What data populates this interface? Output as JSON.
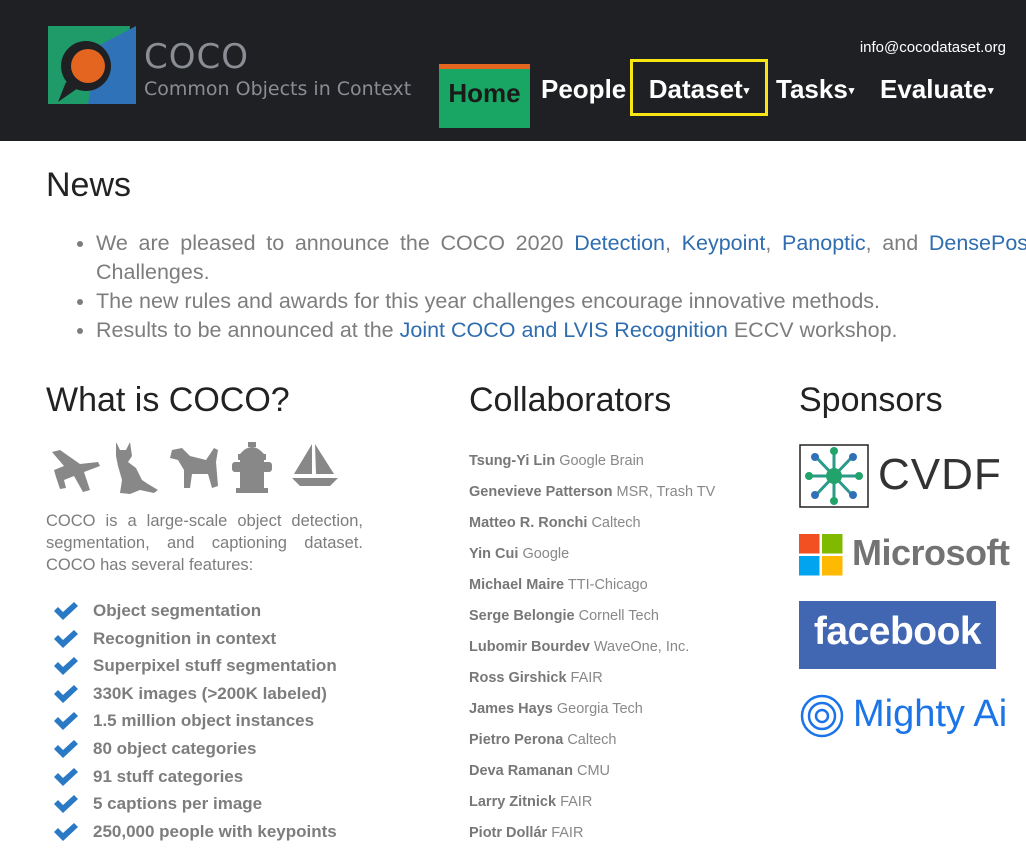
{
  "header": {
    "brand_name": "COCO",
    "brand_tagline": "Common Objects in Context",
    "email": "info@cocodataset.org",
    "nav": {
      "home": "Home",
      "people": "People",
      "dataset": "Dataset",
      "tasks": "Tasks",
      "evaluate": "Evaluate"
    },
    "caret": "▾",
    "colors": {
      "bg": "#1f2023",
      "home_bg": "#19a563",
      "home_top": "#e4651f",
      "highlight": "#f7e614"
    }
  },
  "news": {
    "title": "News",
    "items": [
      {
        "t1": "We are pleased to announce the COCO 2020 ",
        "l1": "Detection",
        "t2": ", ",
        "l2": "Keypoint",
        "t3": ", ",
        "l3": "Panoptic",
        "t4": ", and ",
        "l4": "DensePose",
        "t5": " Challenges."
      },
      {
        "text": "The new rules and awards for this year challenges encourage innovative methods."
      },
      {
        "t1": "Results to be announced at the ",
        "l1": "Joint COCO and LVIS Recognition",
        "t2": " ECCV workshop."
      }
    ]
  },
  "what": {
    "title": "What is COCO?",
    "icons": [
      "airplane-icon",
      "cat-icon",
      "dog-icon",
      "fire-hydrant-icon",
      "sailboat-icon"
    ],
    "description": "COCO is a large-scale object detection, segmentation, and captioning dataset. COCO has several features:",
    "features": [
      "Object segmentation",
      "Recognition in context",
      "Superpixel stuff segmentation",
      "330K images (>200K labeled)",
      "1.5 million object instances",
      "80 object categories",
      "91 stuff categories",
      "5 captions per image",
      "250,000 people with keypoints"
    ]
  },
  "collaborators": {
    "title": "Collaborators",
    "people": [
      {
        "name": "Tsung-Yi Lin",
        "org": "Google Brain"
      },
      {
        "name": "Genevieve Patterson",
        "org": "MSR, Trash TV"
      },
      {
        "name": "Matteo R. Ronchi",
        "org": "Caltech"
      },
      {
        "name": "Yin Cui",
        "org": "Google"
      },
      {
        "name": "Michael Maire",
        "org": "TTI-Chicago"
      },
      {
        "name": "Serge Belongie",
        "org": "Cornell Tech"
      },
      {
        "name": "Lubomir Bourdev",
        "org": "WaveOne, Inc."
      },
      {
        "name": "Ross Girshick",
        "org": "FAIR"
      },
      {
        "name": "James Hays",
        "org": "Georgia Tech"
      },
      {
        "name": "Pietro Perona",
        "org": "Caltech"
      },
      {
        "name": "Deva Ramanan",
        "org": "CMU"
      },
      {
        "name": "Larry Zitnick",
        "org": "FAIR"
      },
      {
        "name": "Piotr Dollár",
        "org": "FAIR"
      }
    ]
  },
  "sponsors": {
    "title": "Sponsors",
    "cvdf": "CVDF",
    "microsoft": "Microsoft",
    "facebook": "facebook",
    "mighty": "Mighty Ai"
  }
}
